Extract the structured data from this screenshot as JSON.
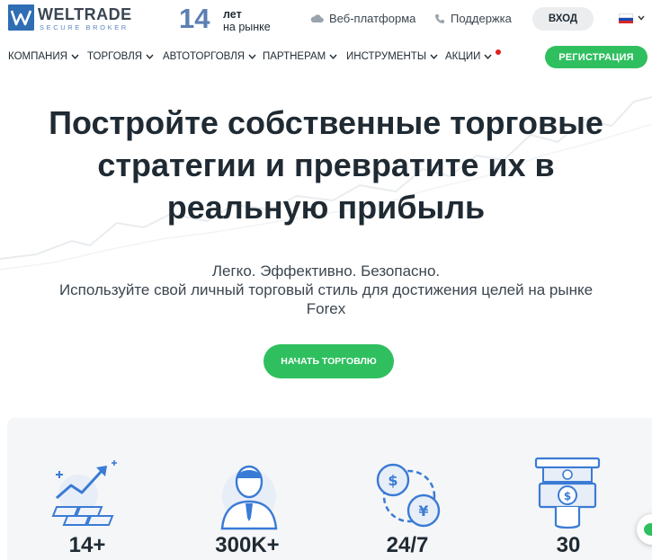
{
  "brand": {
    "name": "WELTRADE",
    "tagline": "SECURE BROKER",
    "years_number": "14",
    "years_line1": "лет",
    "years_line2": "на рынке"
  },
  "header": {
    "web_platform": "Веб-платформа",
    "support": "Поддержка",
    "login": "ВХОД",
    "register": "РЕГИСТРАЦИЯ"
  },
  "nav": {
    "items": [
      "КОМПАНИЯ",
      "ТОРГОВЛЯ",
      "АВТОТОРГОВЛЯ",
      "ПАРТНЕРАМ",
      "ИНСТРУМЕНТЫ",
      "АКЦИИ"
    ]
  },
  "hero": {
    "title_line1": "Постройте собственные торговые",
    "title_line2": "стратегии и превратите их в",
    "title_line3": "реальную прибыль",
    "sub_line1": "Легко. Эффективно. Безопасно.",
    "sub_line2": "Используйте свой личный торговый стиль для достижения целей на рынке",
    "sub_line3": "Forex",
    "cta": "НАЧАТЬ ТОРГОВЛЮ"
  },
  "stats": [
    {
      "value": "14+",
      "icon": "gold-growth-icon"
    },
    {
      "value": "300K+",
      "icon": "client-avatar-icon"
    },
    {
      "value": "24/7",
      "icon": "currency-exchange-icon"
    },
    {
      "value": "30",
      "icon": "cash-withdrawal-icon"
    }
  ],
  "colors": {
    "accent_green": "#2fbf5f",
    "brand_blue": "#2f6db4",
    "text_dark": "#1f2a33",
    "icon_blue": "#3a7bd5"
  }
}
